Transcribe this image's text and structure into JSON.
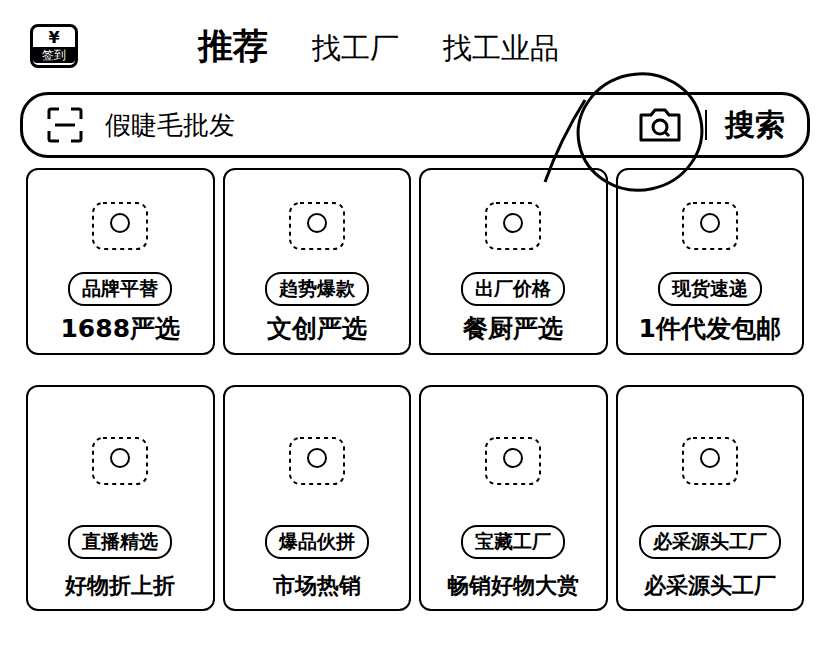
{
  "header": {
    "signin": {
      "icon": "¥",
      "label": "签到"
    }
  },
  "tabs": [
    {
      "label": "推荐",
      "selected": true
    },
    {
      "label": "找工厂",
      "selected": false
    },
    {
      "label": "找工业品",
      "selected": false
    }
  ],
  "search": {
    "placeholder": "假睫毛批发",
    "button": "搜索"
  },
  "rows": [
    {
      "kind": "top",
      "cards": [
        {
          "badge": "品牌平替",
          "label": "1688严选"
        },
        {
          "badge": "趋势爆款",
          "label": "文创严选"
        },
        {
          "badge": "出厂价格",
          "label": "餐厨严选"
        },
        {
          "badge": "现货速递",
          "label": "1件代发包邮"
        }
      ]
    },
    {
      "kind": "bottom",
      "cards": [
        {
          "badge": "直播精选",
          "label": "好物折上折"
        },
        {
          "badge": "爆品伙拼",
          "label": "市场热销"
        },
        {
          "badge": "宝藏工厂",
          "label": "畅销好物大赏"
        },
        {
          "badge": "必采源头工厂",
          "label": "必采源头工厂"
        }
      ]
    }
  ]
}
